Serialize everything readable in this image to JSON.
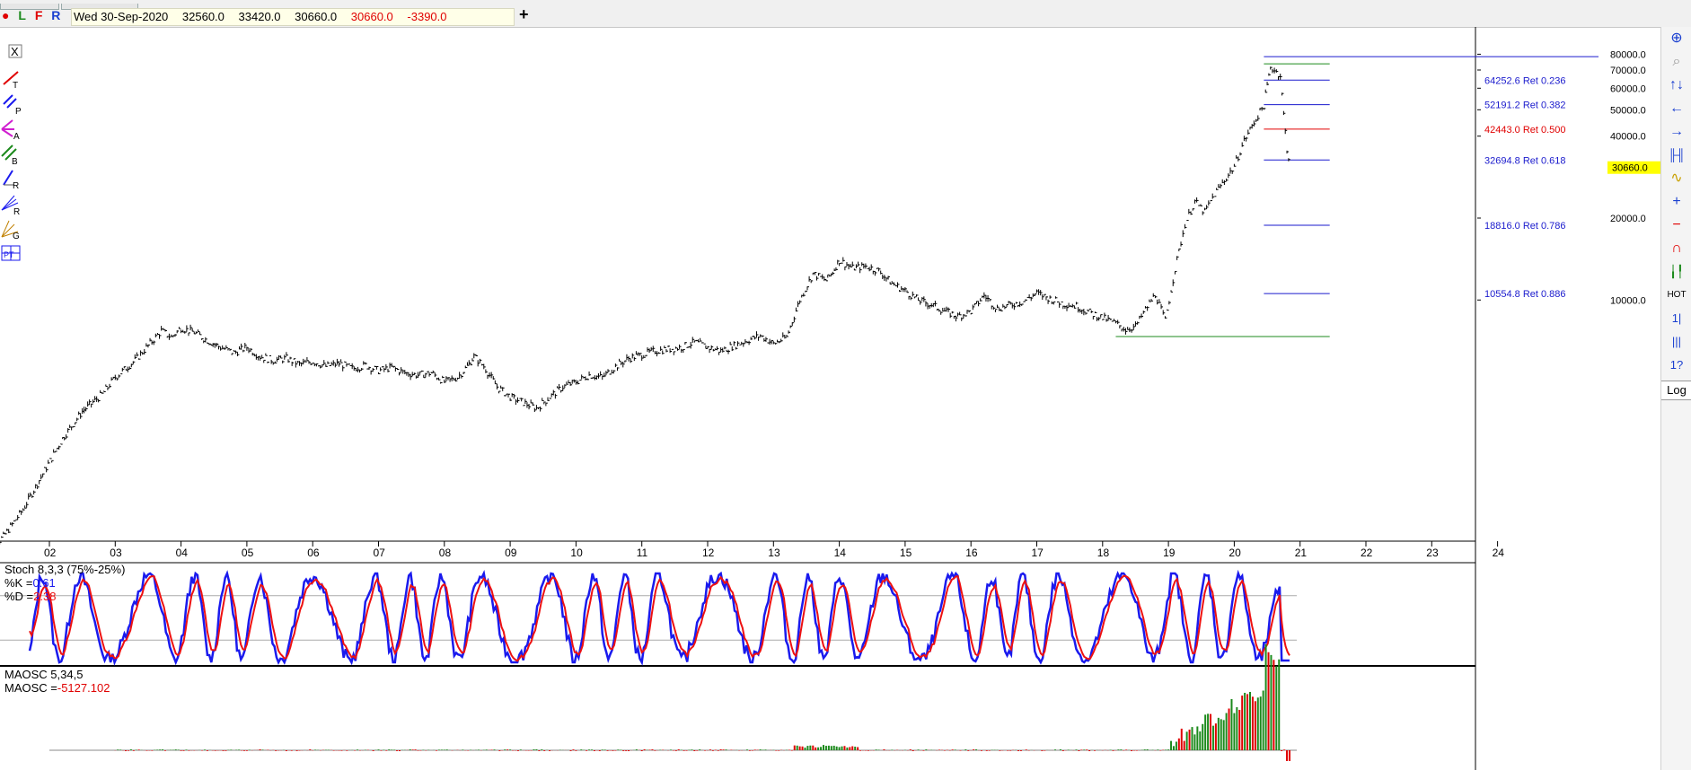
{
  "toolbar": {
    "mode_buttons": [
      {
        "label": "●",
        "color": "#e00000"
      },
      {
        "label": "L",
        "color": "#1c8a1c"
      },
      {
        "label": "F",
        "color": "#e00000"
      },
      {
        "label": "R",
        "color": "#1a3fd0"
      }
    ],
    "quote": {
      "date": "Wed 30-Sep-2020",
      "open": "32560.0",
      "high": "33420.0",
      "low": "30660.0",
      "close": "30660.0",
      "change": "-3390.0"
    },
    "add_tab_label": "+"
  },
  "left_tools": [
    {
      "icon": "cursor-x-icon",
      "glyph": "X"
    },
    {
      "icon": "trendline-icon",
      "glyph": "T"
    },
    {
      "icon": "parallel-lines-icon",
      "glyph": "P"
    },
    {
      "icon": "andrews-pitchfork-icon",
      "glyph": "A"
    },
    {
      "icon": "channel-b-icon",
      "glyph": "B"
    },
    {
      "icon": "retracement-r-icon",
      "glyph": "R"
    },
    {
      "icon": "fan-r-icon",
      "glyph": "R"
    },
    {
      "icon": "gann-fan-icon",
      "glyph": "G"
    },
    {
      "icon": "pt-grid-icon",
      "glyph": "PT"
    }
  ],
  "right_tools": [
    {
      "icon": "zoom-in-icon",
      "glyph": "⊕"
    },
    {
      "icon": "magnifier-icon",
      "glyph": "⌕"
    },
    {
      "icon": "scroll-arrows-icon",
      "glyph": "↑↓"
    },
    {
      "icon": "arrow-left-icon",
      "glyph": "←"
    },
    {
      "icon": "arrow-right-icon",
      "glyph": "→"
    },
    {
      "icon": "bars-icon",
      "glyph": "╠"
    },
    {
      "icon": "line-icon",
      "glyph": "∿"
    },
    {
      "icon": "plus-icon",
      "glyph": "+"
    },
    {
      "icon": "minus-icon",
      "glyph": "−"
    },
    {
      "icon": "magnet-icon",
      "glyph": "∩"
    },
    {
      "icon": "stacked-bars-icon",
      "glyph": "┃"
    },
    {
      "icon": "hot-icon",
      "glyph": "HOT"
    },
    {
      "icon": "scale-bars-1-icon",
      "glyph": "│"
    },
    {
      "icon": "scale-bars-2-icon",
      "glyph": "│"
    },
    {
      "icon": "scale-bars-3-icon",
      "glyph": "↕"
    }
  ],
  "log_button": "Log",
  "chart_data": [
    {
      "type": "ohlc",
      "x_tick_labels": [
        "02",
        "03",
        "04",
        "05",
        "06",
        "07",
        "08",
        "09",
        "10",
        "11",
        "12",
        "13",
        "14",
        "15",
        "16",
        "17",
        "18",
        "19",
        "20",
        "21",
        "22",
        "23",
        "24"
      ],
      "x_tick_years": [
        2002,
        2003,
        2004,
        2005,
        2006,
        2007,
        2008,
        2009,
        2010,
        2011,
        2012,
        2013,
        2014,
        2015,
        2016,
        2017,
        2018,
        2019,
        2020,
        2021,
        2022,
        2023,
        2024
      ],
      "y_scale": "log",
      "y_ticks": [
        "80000.0",
        "70000.0",
        "60000.0",
        "50000.0",
        "40000.0",
        "20000.0",
        "10000.0"
      ],
      "y_tick_values": [
        80000,
        70000,
        60000,
        50000,
        40000,
        20000,
        10000
      ],
      "last_price": "30660.0",
      "last_price_value": 30660,
      "price_path": [
        [
          2001.0,
          1150
        ],
        [
          2001.3,
          1350
        ],
        [
          2001.6,
          1700
        ],
        [
          2001.9,
          2300
        ],
        [
          2002.2,
          3100
        ],
        [
          2002.5,
          3900
        ],
        [
          2002.8,
          4500
        ],
        [
          2003.0,
          5200
        ],
        [
          2003.3,
          6000
        ],
        [
          2003.5,
          6800
        ],
        [
          2003.7,
          7700
        ],
        [
          2003.85,
          7300
        ],
        [
          2004.0,
          7900
        ],
        [
          2004.2,
          7600
        ],
        [
          2004.4,
          7100
        ],
        [
          2004.6,
          6700
        ],
        [
          2004.8,
          6400
        ],
        [
          2005.0,
          6700
        ],
        [
          2005.2,
          6200
        ],
        [
          2005.4,
          6000
        ],
        [
          2005.6,
          6100
        ],
        [
          2005.8,
          5800
        ],
        [
          2006.0,
          5950
        ],
        [
          2006.2,
          5700
        ],
        [
          2006.4,
          5850
        ],
        [
          2006.6,
          5600
        ],
        [
          2006.8,
          5750
        ],
        [
          2007.0,
          5500
        ],
        [
          2007.2,
          5650
        ],
        [
          2007.4,
          5400
        ],
        [
          2007.6,
          5300
        ],
        [
          2007.8,
          5400
        ],
        [
          2008.0,
          5000
        ],
        [
          2008.2,
          5200
        ],
        [
          2008.35,
          5700
        ],
        [
          2008.45,
          6200
        ],
        [
          2008.6,
          5700
        ],
        [
          2008.8,
          4800
        ],
        [
          2009.0,
          4400
        ],
        [
          2009.2,
          4200
        ],
        [
          2009.4,
          4000
        ],
        [
          2009.6,
          4400
        ],
        [
          2009.8,
          4800
        ],
        [
          2010.0,
          5000
        ],
        [
          2010.2,
          5300
        ],
        [
          2010.4,
          5200
        ],
        [
          2010.6,
          5700
        ],
        [
          2010.8,
          6100
        ],
        [
          2011.0,
          6300
        ],
        [
          2011.2,
          6500
        ],
        [
          2011.4,
          6600
        ],
        [
          2011.6,
          6700
        ],
        [
          2011.8,
          7000
        ],
        [
          2012.0,
          6700
        ],
        [
          2012.2,
          6500
        ],
        [
          2012.4,
          6800
        ],
        [
          2012.6,
          7100
        ],
        [
          2012.8,
          7400
        ],
        [
          2013.0,
          6900
        ],
        [
          2013.2,
          7300
        ],
        [
          2013.4,
          10000
        ],
        [
          2013.6,
          12500
        ],
        [
          2013.8,
          11800
        ],
        [
          2013.9,
          12700
        ],
        [
          2014.0,
          14000
        ],
        [
          2014.2,
          13100
        ],
        [
          2014.4,
          13300
        ],
        [
          2014.6,
          12800
        ],
        [
          2014.8,
          11500
        ],
        [
          2015.0,
          10800
        ],
        [
          2015.2,
          10000
        ],
        [
          2015.4,
          9600
        ],
        [
          2015.6,
          9100
        ],
        [
          2015.8,
          8700
        ],
        [
          2016.0,
          9100
        ],
        [
          2016.2,
          10400
        ],
        [
          2016.4,
          9300
        ],
        [
          2016.6,
          9600
        ],
        [
          2016.8,
          9900
        ],
        [
          2017.0,
          10600
        ],
        [
          2017.2,
          10100
        ],
        [
          2017.4,
          9700
        ],
        [
          2017.6,
          9500
        ],
        [
          2017.8,
          9000
        ],
        [
          2018.0,
          8600
        ],
        [
          2018.2,
          8200
        ],
        [
          2018.35,
          7800
        ],
        [
          2018.5,
          8000
        ],
        [
          2018.65,
          9200
        ],
        [
          2018.8,
          10500
        ],
        [
          2018.95,
          8400
        ],
        [
          2019.1,
          13000
        ],
        [
          2019.25,
          19000
        ],
        [
          2019.4,
          23000
        ],
        [
          2019.55,
          21000
        ],
        [
          2019.7,
          24500
        ],
        [
          2019.85,
          27500
        ],
        [
          2020.0,
          31000
        ],
        [
          2020.15,
          38500
        ],
        [
          2020.3,
          45000
        ],
        [
          2020.45,
          52000
        ],
        [
          2020.55,
          72000
        ],
        [
          2020.7,
          67000
        ],
        [
          2020.75,
          48000
        ],
        [
          2020.8,
          36000
        ],
        [
          2020.85,
          30660
        ]
      ],
      "fib_levels": [
        {
          "label": "64252.6 Ret 0.236",
          "value": 64252.6,
          "color": "#1a1acd"
        },
        {
          "label": "52191.2 Ret 0.382",
          "value": 52191.2,
          "color": "#1a1acd"
        },
        {
          "label": "42443.0 Ret 0.500",
          "value": 42443.0,
          "color": "#e00000"
        },
        {
          "label": "32694.8 Ret 0.618",
          "value": 32694.8,
          "color": "#1a1acd"
        },
        {
          "label": "18816.0 Ret 0.786",
          "value": 18816.0,
          "color": "#1a1acd"
        },
        {
          "label": "10554.8 Ret 0.886",
          "value": 10554.8,
          "color": "#1a1acd"
        }
      ],
      "fib_high": 76000,
      "fib_low": 7800,
      "colors": {
        "bars": "#000000",
        "fib": "#1a1acd",
        "fib_mid": "#e00000",
        "anchor": "#1c8a1c",
        "last_price_bg": "#ffff00"
      }
    },
    {
      "type": "line",
      "title": "Stoch 8,3,3 (75%-25%)",
      "k_label": "%K =",
      "k_value": "0.61",
      "d_label": "%D =",
      "d_value": "2.38",
      "ylim": [
        0,
        100
      ],
      "bands": [
        75,
        25
      ],
      "series": [
        {
          "name": "%K",
          "color": "#1a1aee"
        },
        {
          "name": "%D",
          "color": "#ee1111"
        }
      ]
    },
    {
      "type": "bar",
      "title": "MAOSC 5,34,5",
      "value_label": "MAOSC =",
      "value": "-5127.102",
      "colors": {
        "up": "#1c8a1c",
        "down": "#e00000"
      }
    }
  ]
}
